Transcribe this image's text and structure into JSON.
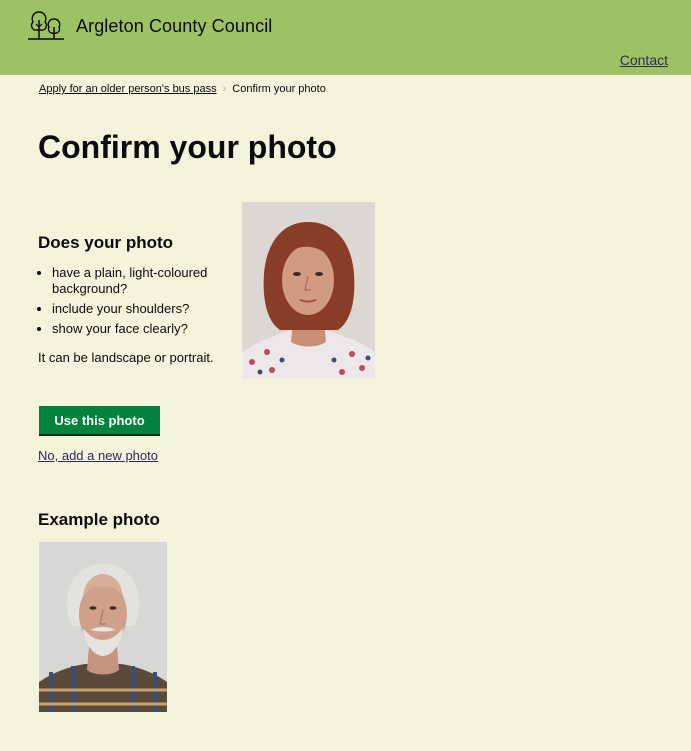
{
  "header": {
    "organisation_name": "Argleton County Council",
    "logo_icon": "trees-icon",
    "nav_contact_label": "Contact"
  },
  "breadcrumbs": {
    "parent_label": "Apply for an older person's bus pass",
    "current_label": "Confirm your photo"
  },
  "main": {
    "title": "Confirm your photo",
    "check_heading": "Does your photo",
    "checklist": [
      "have a plain, light-coloured background?",
      "include your shoulders?",
      "show your face clearly?"
    ],
    "orientation_note": "It can be landscape or portrait.",
    "primary_button_label": "Use this photo",
    "secondary_link_label": "No, add a new photo",
    "example_heading": "Example photo"
  },
  "colors": {
    "header_background": "#9dc264",
    "page_background": "#f4f4dc",
    "primary_button": "#00843d",
    "link": "#2e2a5c"
  }
}
